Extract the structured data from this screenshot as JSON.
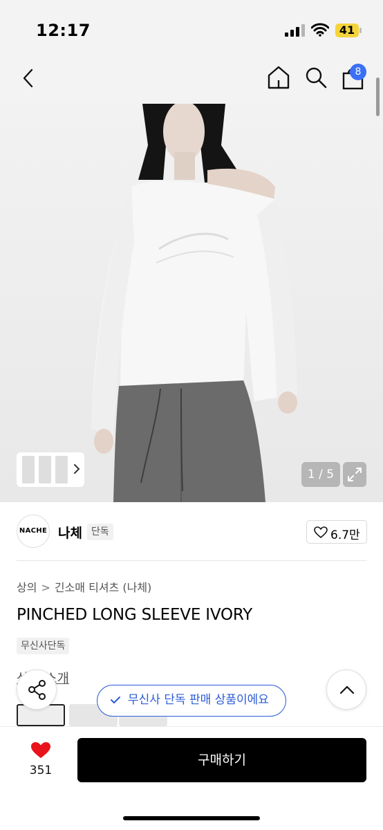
{
  "status_bar": {
    "time": "12:17",
    "battery_level": "41",
    "icons": [
      "signal-icon",
      "wifi-icon",
      "battery-icon"
    ]
  },
  "header": {
    "icons": [
      "back-icon",
      "home-icon",
      "search-icon",
      "cart-icon"
    ],
    "cart_count": "8"
  },
  "gallery": {
    "counter": "1 / 5",
    "expand_icon": "expand-icon"
  },
  "brand": {
    "logo_text": "NACHE",
    "name": "나체",
    "tag": "단독",
    "likes": "6.7만"
  },
  "breadcrumb": {
    "category": "상의",
    "subcategory": "긴소매 티셔츠 (나체)"
  },
  "product": {
    "title": "PINCHED LONG SLEEVE IVORY",
    "tag": "무신사단독"
  },
  "section": {
    "label": "상품 소개"
  },
  "toast": {
    "message": "무신사 단독 판매 상품이에요"
  },
  "bottom_bar": {
    "wish_count": "351",
    "buy_label": "구매하기"
  },
  "colors": {
    "accent": "#2b5bd7",
    "badge": "#3b6ff5",
    "heart": "#e8131b",
    "buy_button": "#000000"
  }
}
